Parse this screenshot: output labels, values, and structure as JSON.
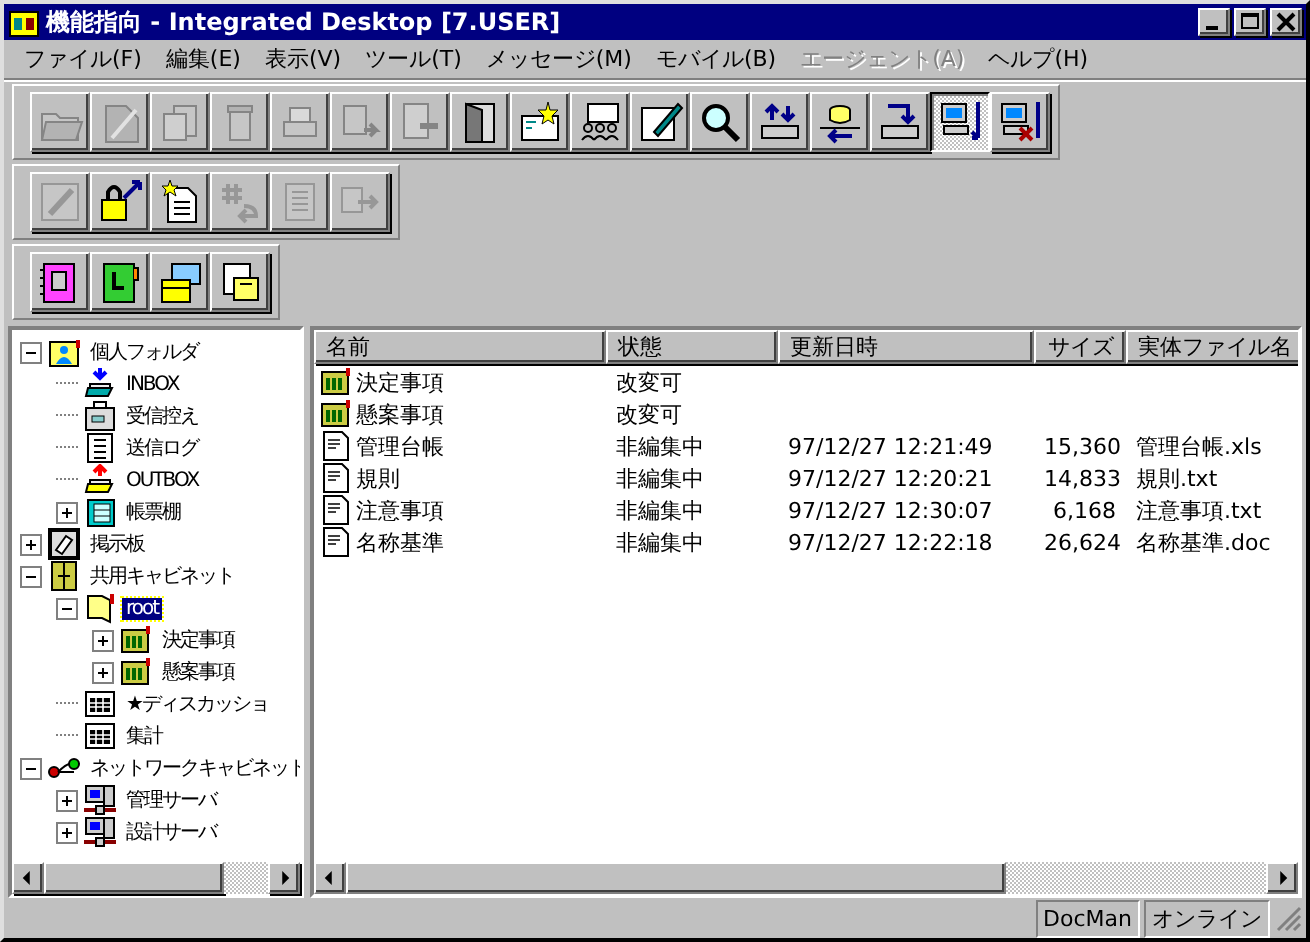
{
  "window": {
    "title": "機能指向 - Integrated Desktop [7.USER]"
  },
  "menu": [
    {
      "label": "ファイル(F)",
      "disabled": false
    },
    {
      "label": "編集(E)",
      "disabled": false
    },
    {
      "label": "表示(V)",
      "disabled": false
    },
    {
      "label": "ツール(T)",
      "disabled": false
    },
    {
      "label": "メッセージ(M)",
      "disabled": false
    },
    {
      "label": "モバイル(B)",
      "disabled": false
    },
    {
      "label": "エージェント(A)",
      "disabled": true
    },
    {
      "label": "ヘルプ(H)",
      "disabled": false
    }
  ],
  "toolbars": [
    {
      "buttons": [
        {
          "disabled": true,
          "pressed": false
        },
        {
          "disabled": true,
          "pressed": false
        },
        {
          "disabled": true,
          "pressed": false
        },
        {
          "disabled": true,
          "pressed": false
        },
        {
          "disabled": true,
          "pressed": false
        },
        {
          "disabled": true,
          "pressed": false
        },
        {
          "disabled": true,
          "pressed": false
        },
        {
          "disabled": false,
          "pressed": false
        },
        {
          "disabled": false,
          "pressed": false
        },
        {
          "disabled": false,
          "pressed": false
        },
        {
          "disabled": false,
          "pressed": false
        },
        {
          "disabled": false,
          "pressed": false
        },
        {
          "disabled": false,
          "pressed": false
        },
        {
          "disabled": false,
          "pressed": false
        },
        {
          "disabled": false,
          "pressed": false
        },
        {
          "disabled": false,
          "pressed": true
        },
        {
          "disabled": false,
          "pressed": false
        }
      ]
    },
    {
      "buttons": [
        {
          "disabled": true,
          "pressed": false
        },
        {
          "disabled": false,
          "pressed": false
        },
        {
          "disabled": false,
          "pressed": false
        },
        {
          "disabled": true,
          "pressed": false
        },
        {
          "disabled": true,
          "pressed": false
        },
        {
          "disabled": true,
          "pressed": false
        }
      ]
    },
    {
      "buttons": [
        {
          "disabled": false,
          "pressed": false
        },
        {
          "disabled": false,
          "pressed": false
        },
        {
          "disabled": false,
          "pressed": false
        },
        {
          "disabled": false,
          "pressed": false
        }
      ]
    }
  ],
  "tree": [
    {
      "label": "個人フォルダ",
      "kind": "person",
      "expanded": true,
      "selected": false,
      "children": [
        {
          "label": "INBOX",
          "kind": "inbox",
          "selected": false
        },
        {
          "label": "受信控え",
          "kind": "case",
          "selected": false
        },
        {
          "label": "送信ログ",
          "kind": "log",
          "selected": false
        },
        {
          "label": "OUTBOX",
          "kind": "outbox",
          "selected": false
        },
        {
          "label": "帳票棚",
          "kind": "binder",
          "expanded": false,
          "selected": false
        }
      ]
    },
    {
      "label": "掲示板",
      "kind": "board",
      "expanded": false,
      "selected": false
    },
    {
      "label": "共用キャビネット",
      "kind": "cabinet",
      "expanded": true,
      "selected": false,
      "children": [
        {
          "label": "root",
          "kind": "folder",
          "expanded": true,
          "selected": true,
          "children": [
            {
              "label": "決定事項",
              "kind": "group",
              "expanded": false,
              "selected": false
            },
            {
              "label": "懸案事項",
              "kind": "group",
              "expanded": false,
              "selected": false
            }
          ]
        },
        {
          "label": "★ディスカッショ",
          "kind": "table",
          "selected": false
        },
        {
          "label": "集計",
          "kind": "table",
          "selected": false
        }
      ]
    },
    {
      "label": "ネットワークキャビネット",
      "kind": "network",
      "expanded": true,
      "selected": false,
      "children": [
        {
          "label": "管理サーバ",
          "kind": "server",
          "expanded": false,
          "selected": false
        },
        {
          "label": "設計サーバ",
          "kind": "server",
          "expanded": false,
          "selected": false
        }
      ]
    }
  ],
  "list": {
    "columns": [
      "名前",
      "状態",
      "更新日時",
      "サイズ",
      "実体ファイル名"
    ],
    "rows": [
      {
        "kind": "group",
        "name": "決定事項",
        "status": "改変可",
        "modified": "",
        "size": "",
        "file": ""
      },
      {
        "kind": "group",
        "name": "懸案事項",
        "status": "改変可",
        "modified": "",
        "size": "",
        "file": ""
      },
      {
        "kind": "document",
        "name": "管理台帳",
        "status": "非編集中",
        "modified": "97/12/27 12:21:49",
        "size": "15,360",
        "file": "管理台帳.xls"
      },
      {
        "kind": "document",
        "name": "規則",
        "status": "非編集中",
        "modified": "97/12/27 12:20:21",
        "size": "14,833",
        "file": "規則.txt"
      },
      {
        "kind": "document",
        "name": "注意事項",
        "status": "非編集中",
        "modified": "97/12/27 12:30:07",
        "size": "6,168",
        "file": "注意事項.txt"
      },
      {
        "kind": "document",
        "name": "名称基準",
        "status": "非編集中",
        "modified": "97/12/27 12:22:18",
        "size": "26,624",
        "file": "名称基準.doc"
      }
    ]
  },
  "status_bar": [
    "DocMan",
    "オンライン"
  ]
}
